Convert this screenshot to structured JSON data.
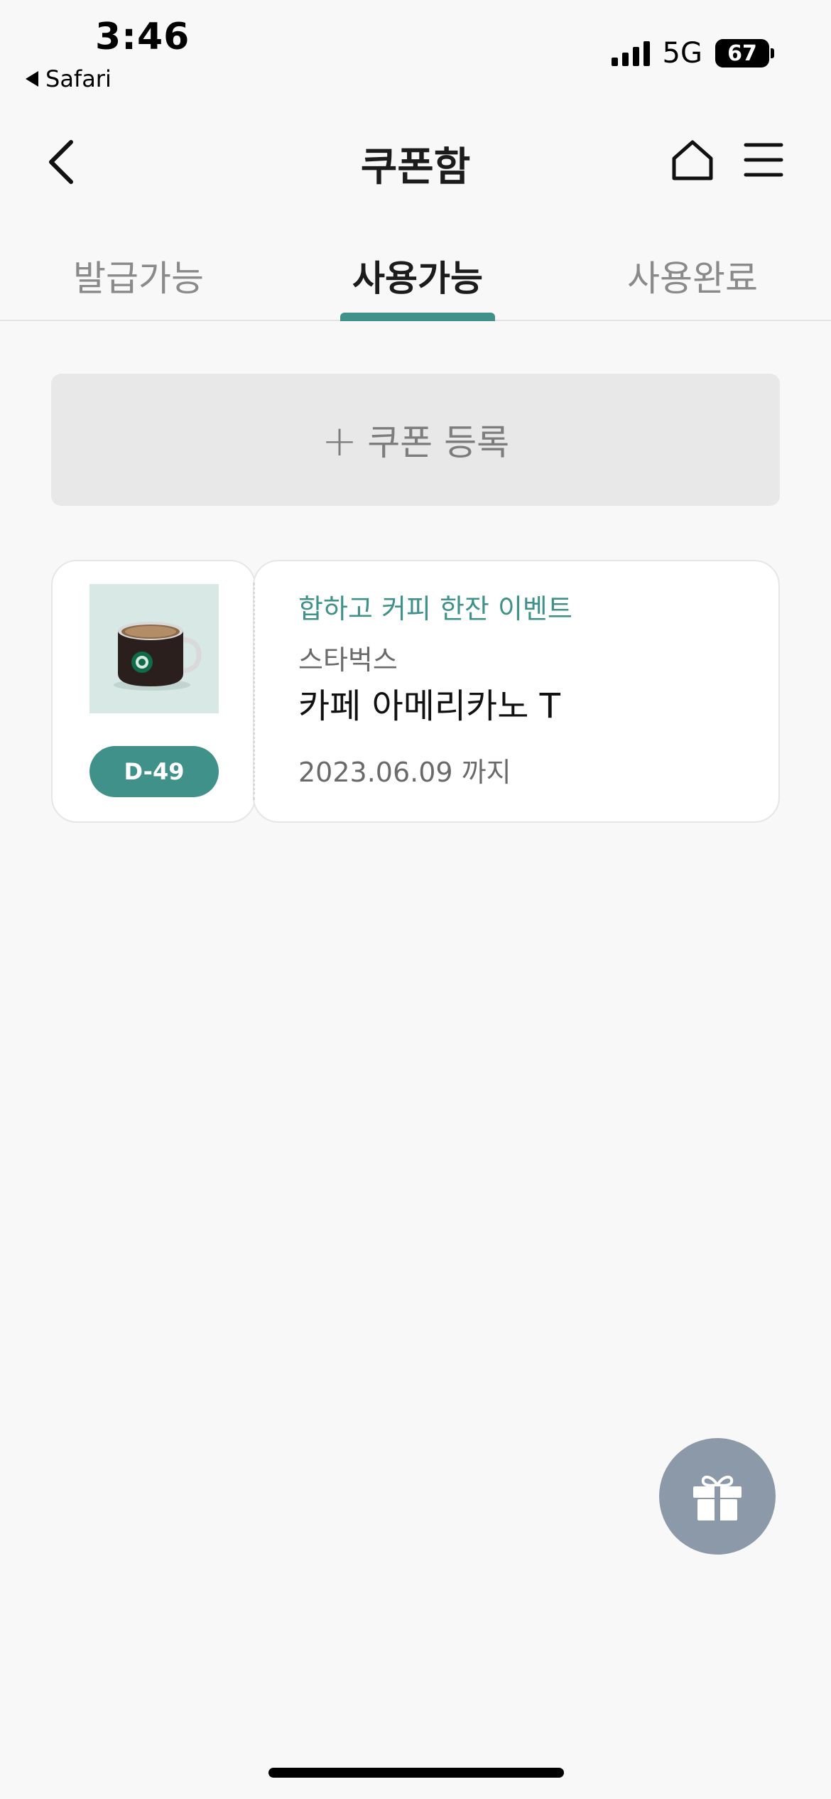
{
  "status_bar": {
    "time": "3:46",
    "back_app": "Safari",
    "network": "5G",
    "battery": "67"
  },
  "header": {
    "title": "쿠폰함",
    "icons": {
      "back": "chevron-left-icon",
      "home": "home-icon",
      "menu": "hamburger-menu-icon"
    }
  },
  "tabs": [
    {
      "label": "발급가능",
      "active": false
    },
    {
      "label": "사용가능",
      "active": true
    },
    {
      "label": "사용완료",
      "active": false
    }
  ],
  "register": {
    "label": "쿠폰 등록",
    "icon": "plus-icon"
  },
  "coupons": [
    {
      "dday": "D-49",
      "event": "합하고 커피 한잔 이벤트",
      "brand": "스타벅스",
      "product": "카페 아메리카노 T",
      "expiry": "2023.06.09 까지",
      "image": "coffee-mug-image"
    }
  ],
  "colors": {
    "accent": "#3f9189",
    "fab": "#8b99a8",
    "background": "#f8f8f8"
  },
  "fab": {
    "icon": "gift-icon"
  }
}
